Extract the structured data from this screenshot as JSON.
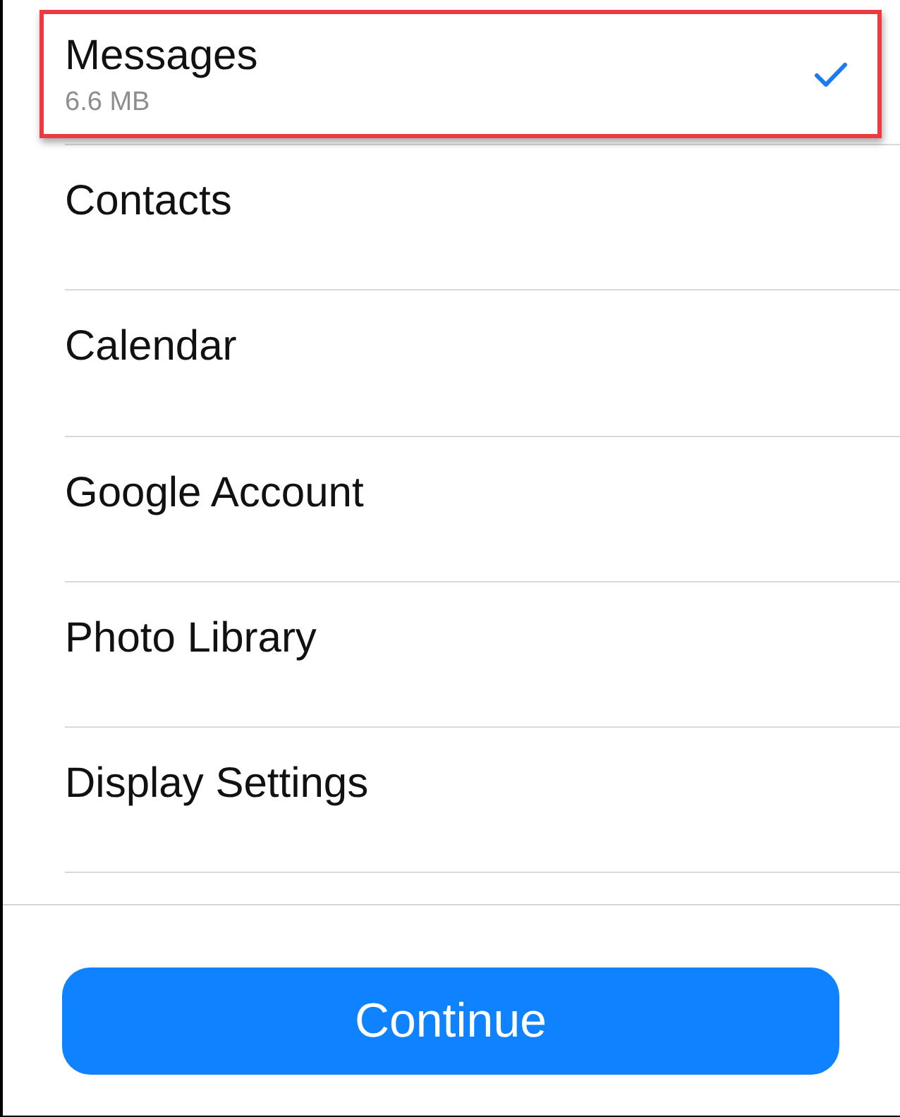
{
  "items": [
    {
      "label": "Messages",
      "detail": "6.6 MB",
      "checked": true,
      "highlighted": true
    },
    {
      "label": "Contacts",
      "checked": false,
      "highlighted": false
    },
    {
      "label": "Calendar",
      "checked": false,
      "highlighted": false
    },
    {
      "label": "Google Account",
      "checked": false,
      "highlighted": false
    },
    {
      "label": "Photo Library",
      "checked": false,
      "highlighted": false
    },
    {
      "label": "Display Settings",
      "checked": false,
      "highlighted": false
    }
  ],
  "button": {
    "label": "Continue"
  }
}
